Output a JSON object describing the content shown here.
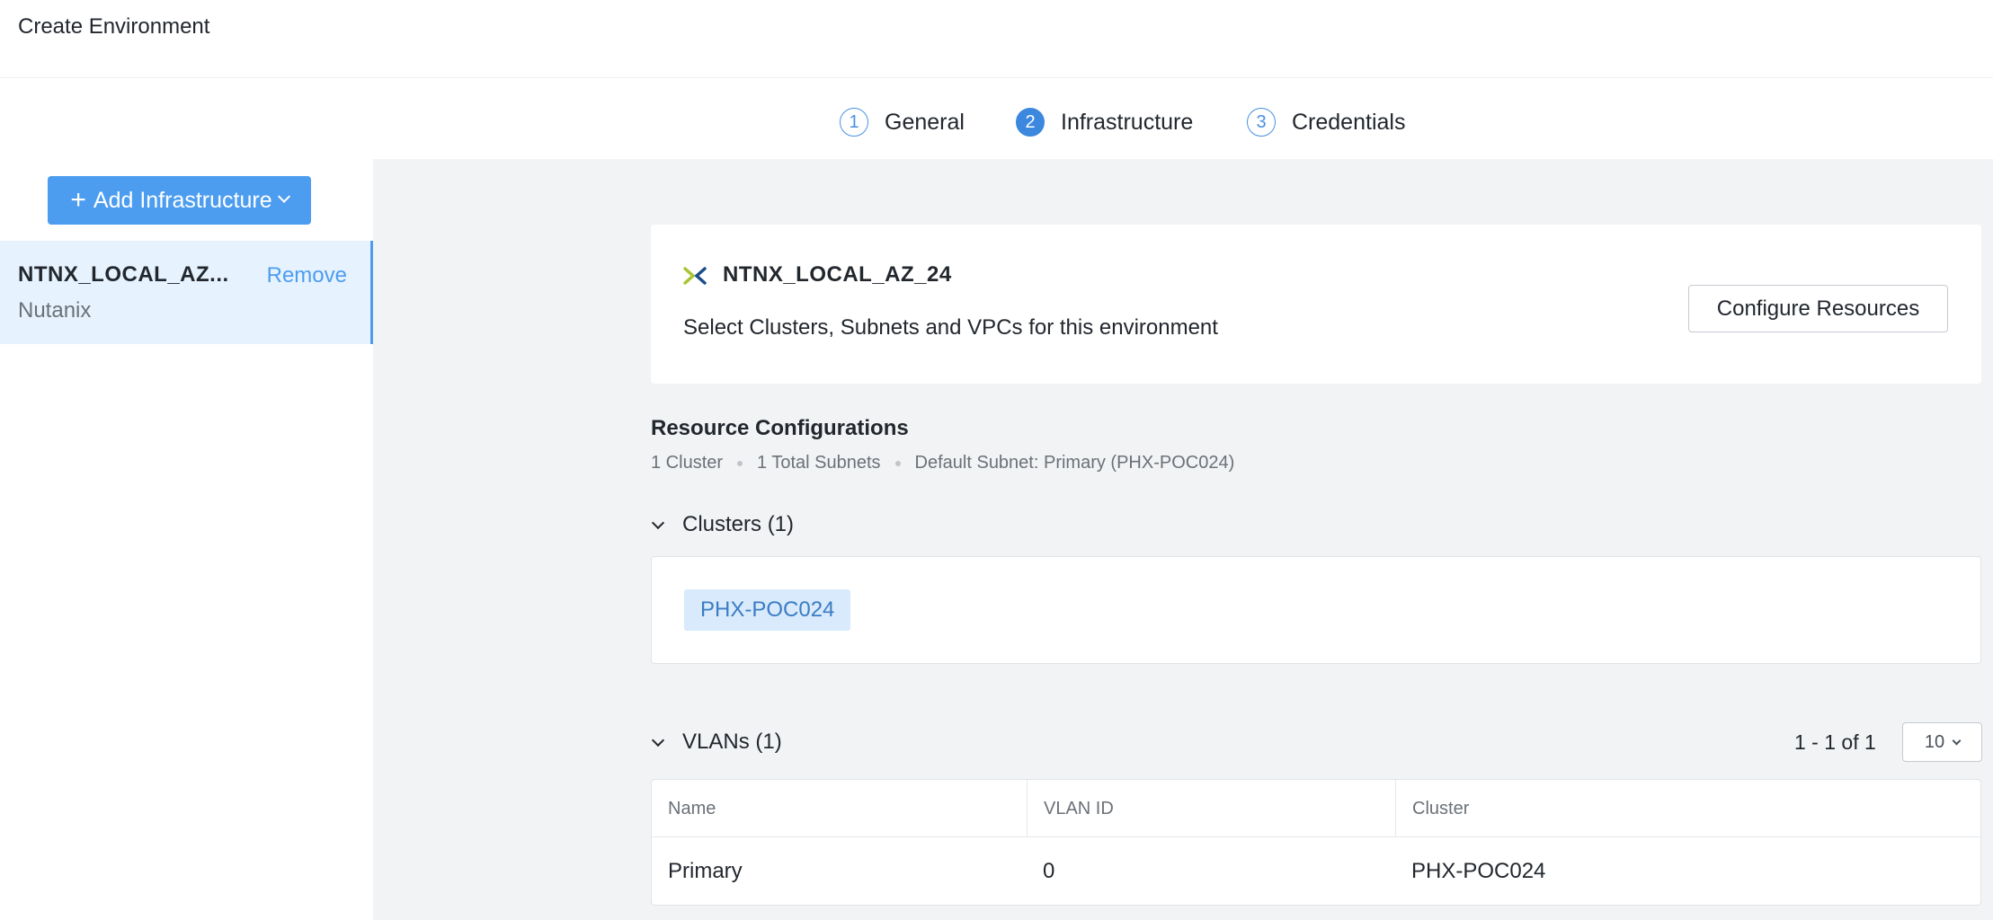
{
  "window": {
    "title": "Create Environment"
  },
  "stepper": {
    "steps": [
      {
        "num": "1",
        "label": "General"
      },
      {
        "num": "2",
        "label": "Infrastructure"
      },
      {
        "num": "3",
        "label": "Credentials"
      }
    ],
    "active_step": "2"
  },
  "sidebar": {
    "add_button_label": "Add Infrastructure",
    "items": [
      {
        "name": "NTNX_LOCAL_AZ...",
        "provider": "Nutanix",
        "remove_label": "Remove"
      }
    ]
  },
  "account_card": {
    "icon": "nutanix-logo-icon",
    "name": "NTNX_LOCAL_AZ_24",
    "description": "Select Clusters, Subnets and VPCs for this environment",
    "configure_label": "Configure Resources"
  },
  "resource_config": {
    "title": "Resource Configurations",
    "meta": [
      "1 Cluster",
      "1 Total Subnets",
      "Default Subnet: Primary (PHX-POC024)"
    ]
  },
  "clusters": {
    "heading": "Clusters (1)",
    "tags": [
      "PHX-POC024"
    ]
  },
  "vlans": {
    "heading": "VLANs (1)",
    "pagination": "1 - 1 of 1",
    "per_page": "10",
    "columns": [
      "Name",
      "VLAN ID",
      "Cluster"
    ],
    "rows": [
      [
        "Primary",
        "0",
        "PHX-POC024"
      ]
    ]
  },
  "colors": {
    "accent": "#4c9df0",
    "selected_bg": "#e6f2fd",
    "main_bg": "#f2f3f5",
    "tag_bg": "#d8eafc",
    "logo_green": "#a6c531",
    "logo_blue": "#1a4e8a"
  }
}
